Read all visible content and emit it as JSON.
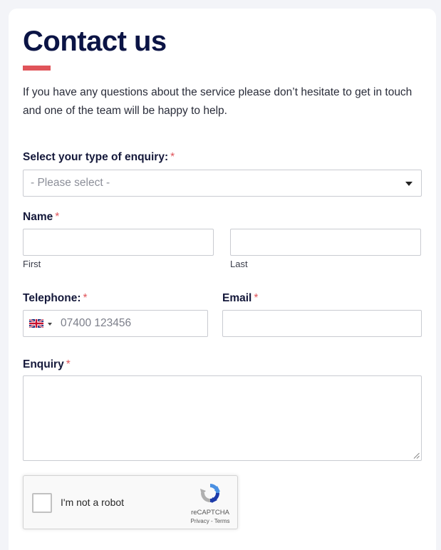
{
  "page": {
    "title": "Contact us",
    "intro": "If you have any questions about the service please don’t hesitate to get in touch and one of the team will be happy to help.",
    "accent_color": "#e0545a",
    "title_color": "#0b1445"
  },
  "form": {
    "required_marker": "*",
    "enquiry_type": {
      "label": "Select your type of enquiry:",
      "selected": "- Please select -"
    },
    "name": {
      "label": "Name",
      "first_value": "",
      "last_value": "",
      "first_sublabel": "First",
      "last_sublabel": "Last"
    },
    "telephone": {
      "label": "Telephone:",
      "country_icon": "uk-flag-icon",
      "placeholder": "07400 123456",
      "value": ""
    },
    "email": {
      "label": "Email",
      "value": ""
    },
    "enquiry": {
      "label": "Enquiry",
      "value": ""
    }
  },
  "recaptcha": {
    "label": "I'm not a robot",
    "brand": "reCAPTCHA",
    "privacy": "Privacy",
    "separator": "-",
    "terms": "Terms",
    "checked": false
  }
}
